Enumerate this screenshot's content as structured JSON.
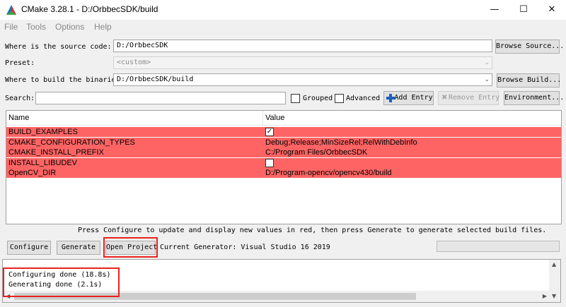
{
  "window": {
    "title": "CMake 3.28.1 - D:/OrbbecSDK/build",
    "minimize": "—",
    "maximize": "☐",
    "close": "✕"
  },
  "menu": [
    "File",
    "Tools",
    "Options",
    "Help"
  ],
  "source": {
    "label": "Where is the source code:",
    "value": "D:/OrbbecSDK",
    "browse": "Browse Source..."
  },
  "preset": {
    "label": "Preset:",
    "value": "<custom>"
  },
  "build": {
    "label": "Where to build the binaries:",
    "value": "D:/OrbbecSDK/build",
    "browse": "Browse Build..."
  },
  "search": {
    "label": "Search:",
    "value": ""
  },
  "toolbar": {
    "grouped": "Grouped",
    "advanced": "Advanced",
    "add_entry": "Add Entry",
    "remove_entry": "Remove Entry",
    "environment": "Environment..."
  },
  "table": {
    "headers": {
      "name": "Name",
      "value": "Value"
    },
    "rows": [
      {
        "name": "BUILD_EXAMPLES",
        "value": "",
        "checkbox": true,
        "checked": true
      },
      {
        "name": "CMAKE_CONFIGURATION_TYPES",
        "value": "Debug;Release;MinSizeRel;RelWithDebInfo"
      },
      {
        "name": "CMAKE_INSTALL_PREFIX",
        "value": "C:/Program Files/OrbbecSDK"
      },
      {
        "name": "INSTALL_LIBUDEV",
        "value": "",
        "checkbox": true,
        "checked": false
      },
      {
        "name": "OpenCV_DIR",
        "value": "D:/Program-opencv/opencv430/build"
      }
    ]
  },
  "hint": "Press Configure to update and display new values in red, then press Generate to generate selected build files.",
  "actions": {
    "configure": "Configure",
    "generate": "Generate",
    "open_project": "Open Project",
    "generator": "Current Generator: Visual Studio 16 2019"
  },
  "output": {
    "lines": [
      "Configuring done (18.8s)",
      "Generating done (2.1s)"
    ]
  },
  "colors": {
    "changed_row": "#fe6464",
    "annotation": "#e8221e"
  }
}
